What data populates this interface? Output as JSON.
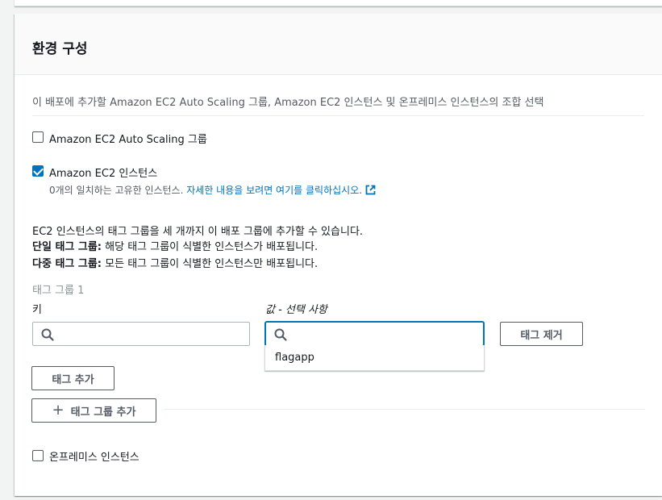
{
  "section": {
    "title": "환경 구성",
    "description": "이 배포에 추가할 Amazon EC2 Auto Scaling 그룹, Amazon EC2 인스턴스 및 온프레미스 인스턴스의 조합 선택"
  },
  "options": {
    "asg": {
      "label": "Amazon EC2 Auto Scaling 그룹",
      "checked": false
    },
    "ec2": {
      "label": "Amazon EC2 인스턴스",
      "checked": true,
      "match_text": "0개의 일치하는 고유한 인스턴스.",
      "link_text": "자세한 내용을 보려면 여기를 클릭하십시오."
    },
    "onprem": {
      "label": "온프레미스 인스턴스",
      "checked": false
    }
  },
  "info": {
    "line1": "EC2 인스턴스의 태그 그룹을 세 개까지 이 배포 그룹에 추가할 수 있습니다.",
    "line2_bold": "단일 태그 그룹:",
    "line2_text": " 해당 태그 그룹이 식별한 인스턴스가 배포됩니다.",
    "line3_bold": "다중 태그 그룹:",
    "line3_text": " 모든 태그 그룹이 식별한 인스턴스만 배포됩니다."
  },
  "tag_group": {
    "title": "태그 그룹 1",
    "key_label": "키",
    "value_label": "값 - 선택 사항",
    "key_value": "",
    "value_value": "",
    "remove_tag_label": "태그 제거",
    "add_tag_label": "태그 추가",
    "suggestions": [
      "flagapp"
    ]
  },
  "add_tag_group_label": "태그 그룹 추가",
  "colors": {
    "accent": "#0073bb",
    "border": "#aab7b8",
    "text_secondary": "#545b64"
  }
}
